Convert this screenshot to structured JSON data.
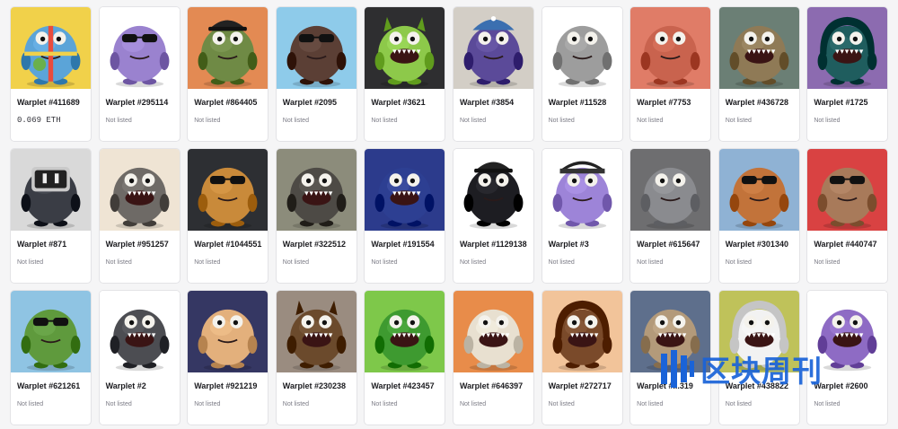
{
  "items": [
    {
      "name": "Warplet #411689",
      "status": "0.069 ETH",
      "bg": "#f1d14a",
      "body": "#5ba4d8",
      "style": "beachball"
    },
    {
      "name": "Warplet #295114",
      "status": "Not listed",
      "bg": "#ffffff",
      "body": "#9a82cf",
      "style": "shades"
    },
    {
      "name": "Warplet #864405",
      "status": "Not listed",
      "bg": "#e38a53",
      "body": "#6f8a45",
      "style": "cap"
    },
    {
      "name": "Warplet #2095",
      "status": "Not listed",
      "bg": "#8ecbea",
      "body": "#5b3f35",
      "style": "shades"
    },
    {
      "name": "Warplet #3621",
      "status": "Not listed",
      "bg": "#2e2e30",
      "body": "#8dc94a",
      "style": "horns"
    },
    {
      "name": "Warplet #3854",
      "status": "Not listed",
      "bg": "#d3cec6",
      "body": "#5b4a99",
      "style": "hat"
    },
    {
      "name": "Warplet #11528",
      "status": "Not listed",
      "bg": "#ffffff",
      "body": "#9d9d9d",
      "style": "plain"
    },
    {
      "name": "Warplet #7753",
      "status": "Not listed",
      "bg": "#e07c67",
      "body": "#c9634e",
      "style": "plain"
    },
    {
      "name": "Warplet #436728",
      "status": "Not listed",
      "bg": "#6b7f75",
      "body": "#8f7a56",
      "style": "teeth"
    },
    {
      "name": "Warplet #1725",
      "status": "Not listed",
      "bg": "#8c6bb0",
      "body": "#1f5d5e",
      "style": "hood"
    },
    {
      "name": "Warplet #871",
      "status": "Not listed",
      "bg": "#d9d9d9",
      "body": "#3a3d45",
      "style": "robot"
    },
    {
      "name": "Warplet #951257",
      "status": "Not listed",
      "bg": "#efe4d4",
      "body": "#6e6a66",
      "style": "teeth"
    },
    {
      "name": "Warplet #1044551",
      "status": "Not listed",
      "bg": "#2d2f33",
      "body": "#c98a3a",
      "style": "shades"
    },
    {
      "name": "Warplet #322512",
      "status": "Not listed",
      "bg": "#8c8c7b",
      "body": "#4d4a45",
      "style": "teeth"
    },
    {
      "name": "Warplet #191554",
      "status": "Not listed",
      "bg": "#2c3b8c",
      "body": "#2d3f92",
      "style": "teeth"
    },
    {
      "name": "Warplet #1129138",
      "status": "Not listed",
      "bg": "#ffffff",
      "body": "#1d1d22",
      "style": "cap"
    },
    {
      "name": "Warplet #3",
      "status": "Not listed",
      "bg": "#ffffff",
      "body": "#9d84d8",
      "style": "pirate"
    },
    {
      "name": "Warplet #615647",
      "status": "Not listed",
      "bg": "#6e6e70",
      "body": "#8a8b8f",
      "style": "plain"
    },
    {
      "name": "Warplet #301340",
      "status": "Not listed",
      "bg": "#8fb2d4",
      "body": "#c2733a",
      "style": "shades"
    },
    {
      "name": "Warplet #440747",
      "status": "Not listed",
      "bg": "#d94242",
      "body": "#a87a5a",
      "style": "shades"
    },
    {
      "name": "Warplet #621261",
      "status": "Not listed",
      "bg": "#8fc4e3",
      "body": "#5f9a3d",
      "style": "shades"
    },
    {
      "name": "Warplet #2",
      "status": "Not listed",
      "bg": "#ffffff",
      "body": "#4c4d52",
      "style": "teeth"
    },
    {
      "name": "Warplet #921219",
      "status": "Not listed",
      "bg": "#353763",
      "body": "#e3b07c",
      "style": "plain"
    },
    {
      "name": "Warplet #230238",
      "status": "Not listed",
      "bg": "#9a8c80",
      "body": "#6b4a2c",
      "style": "horns"
    },
    {
      "name": "Warplet #423457",
      "status": "Not listed",
      "bg": "#7ec84a",
      "body": "#3e9a30",
      "style": "teeth"
    },
    {
      "name": "Warplet #646397",
      "status": "Not listed",
      "bg": "#e88c4a",
      "body": "#e8e0d0",
      "style": "teeth"
    },
    {
      "name": "Warplet #272717",
      "status": "Not listed",
      "bg": "#f2c49a",
      "body": "#7a4a2a",
      "style": "hood"
    },
    {
      "name": "Warplet #...319",
      "status": "Not listed",
      "bg": "#5e6f8c",
      "body": "#b39a7a",
      "style": "teeth"
    },
    {
      "name": "Warplet #438822",
      "status": "Not listed",
      "bg": "#bfc25a",
      "body": "#f2f2f2",
      "style": "hood"
    },
    {
      "name": "Warplet #2600",
      "status": "Not listed",
      "bg": "#ffffff",
      "body": "#8e6bc4",
      "style": "teeth"
    }
  ],
  "watermark": {
    "text": "区块周刊",
    "color": "#1a63d8"
  }
}
